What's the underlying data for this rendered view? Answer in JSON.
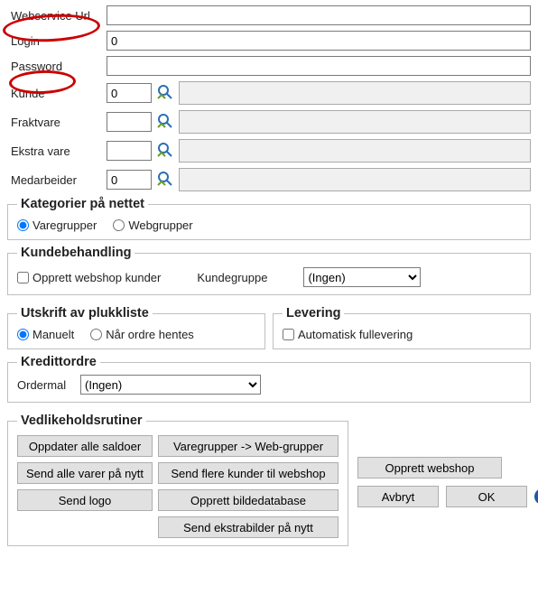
{
  "fields": {
    "webservice_url": {
      "label": "Webservice Url",
      "value": ""
    },
    "login": {
      "label": "Login",
      "value": "0"
    },
    "password": {
      "label": "Password",
      "value": ""
    },
    "kunde": {
      "label": "Kunde",
      "value": "0",
      "display": ""
    },
    "fraktvare": {
      "label": "Fraktvare",
      "value": "",
      "display": ""
    },
    "ekstra_vare": {
      "label": "Ekstra vare",
      "value": "",
      "display": ""
    },
    "medarbeider": {
      "label": "Medarbeider",
      "value": "0",
      "display": ""
    }
  },
  "groups": {
    "kategorier": {
      "legend": "Kategorier på nettet",
      "opt1": "Varegrupper",
      "opt2": "Webgrupper"
    },
    "kundebeh": {
      "legend": "Kundebehandling",
      "check": "Opprett webshop kunder",
      "kglabel": "Kundegruppe",
      "kgvalue": "(Ingen)"
    },
    "utskrift": {
      "legend": "Utskrift av plukkliste",
      "opt1": "Manuelt",
      "opt2": "Når ordre hentes"
    },
    "levering": {
      "legend": "Levering",
      "check": "Automatisk fullevering"
    },
    "kredittordre": {
      "legend": "Kredittordre",
      "orderlabel": "Ordermal",
      "ordervalue": "(Ingen)"
    },
    "vedlikehold": {
      "legend": "Vedlikeholdsrutiner"
    }
  },
  "buttons": {
    "oppdater_saldoer": "Oppdater alle saldoer",
    "varegr_webgr": "Varegrupper -> Web-grupper",
    "send_varer": "Send alle varer på nytt",
    "send_kunder": "Send flere kunder til webshop",
    "send_logo": "Send logo",
    "opprett_bildedb": "Opprett bildedatabase",
    "send_ekstrabilder": "Send ekstrabilder på nytt",
    "opprett_webshop": "Opprett webshop",
    "avbryt": "Avbryt",
    "ok": "OK"
  }
}
